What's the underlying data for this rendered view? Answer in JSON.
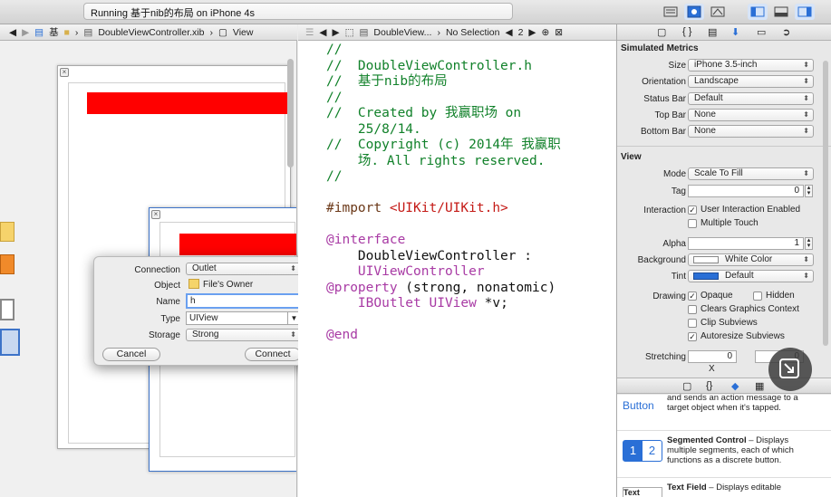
{
  "toolbar": {
    "status": "Running 基于nib的布局 on iPhone 4s"
  },
  "left_jumpbar": {
    "crumbs": [
      "基",
      "DoubleViewController.xib",
      "View"
    ]
  },
  "right_jumpbar": {
    "file": "DoubleView...",
    "selection": "No Selection",
    "counter": "2"
  },
  "editor": {
    "lines": [
      {
        "cls": "cmt",
        "text": "//"
      },
      {
        "cls": "cmt",
        "text": "//  DoubleViewController.h"
      },
      {
        "cls": "cmt",
        "text": "//  基于nib的布局"
      },
      {
        "cls": "cmt",
        "text": "//"
      },
      {
        "cls": "cmt",
        "text": "//  Created by 我赢职场 on"
      },
      {
        "cls": "cmt",
        "text": "    25/8/14."
      },
      {
        "cls": "cmt",
        "text": "//  Copyright (c) 2014年 我赢职"
      },
      {
        "cls": "cmt",
        "text": "    场. All rights reserved."
      },
      {
        "cls": "cmt",
        "text": "//"
      },
      {
        "cls": "plain",
        "text": ""
      },
      {
        "cls": "pre",
        "text": "#import "
      },
      {
        "cls": "plain",
        "text": ""
      },
      {
        "cls": "kw",
        "text": "@interface"
      },
      {
        "cls": "plain",
        "text": "    DoubleViewController :"
      },
      {
        "cls": "kw",
        "text": "    UIViewController"
      },
      {
        "cls": "kw",
        "text": "@property"
      },
      {
        "cls": "kw",
        "text": "    IBOutlet UIView"
      },
      {
        "cls": "plain",
        "text": ""
      },
      {
        "cls": "kw",
        "text": "@end"
      }
    ],
    "import_target": "<UIKit/UIKit.h>",
    "property_attrs": " (strong, nonatomic)",
    "outlet_var": " *v;"
  },
  "dialog": {
    "connection_label": "Connection",
    "connection_value": "Outlet",
    "object_label": "Object",
    "object_value": "File's Owner",
    "name_label": "Name",
    "name_value": "h",
    "type_label": "Type",
    "type_value": "UIView",
    "storage_label": "Storage",
    "storage_value": "Strong",
    "cancel": "Cancel",
    "connect": "Connect"
  },
  "inspector": {
    "simulated_title": "Simulated Metrics",
    "size_label": "Size",
    "size_value": "iPhone 3.5-inch",
    "orientation_label": "Orientation",
    "orientation_value": "Landscape",
    "statusbar_label": "Status Bar",
    "statusbar_value": "Default",
    "topbar_label": "Top Bar",
    "topbar_value": "None",
    "bottombar_label": "Bottom Bar",
    "bottombar_value": "None",
    "view_title": "View",
    "mode_label": "Mode",
    "mode_value": "Scale To Fill",
    "tag_label": "Tag",
    "tag_value": "0",
    "interaction_label": "Interaction",
    "user_interaction": "User Interaction Enabled",
    "multiple_touch": "Multiple Touch",
    "alpha_label": "Alpha",
    "alpha_value": "1",
    "background_label": "Background",
    "background_value": "White Color",
    "tint_label": "Tint",
    "tint_value": "Default",
    "drawing_label": "Drawing",
    "opaque": "Opaque",
    "hidden": "Hidden",
    "clears_graphics": "Clears Graphics Context",
    "clip_subviews": "Clip Subviews",
    "autoresize": "Autoresize Subviews",
    "stretching_label": "Stretching",
    "stretch_x_value": "0",
    "stretch_y_value": "0",
    "stretch_x": "X"
  },
  "library": {
    "items": [
      {
        "icon": "Button",
        "title": "",
        "desc": "and sends an action message to a target object when it's tapped."
      },
      {
        "icon": "1 2",
        "title": "Segmented Control",
        "desc": " – Displays multiple segments, each of which functions as a discrete button."
      },
      {
        "icon": "Text",
        "title": "Text Field",
        "desc": " – Displays editable"
      }
    ]
  },
  "colors": {
    "accent": "#2a6fd6",
    "red_view": "#ff0000",
    "comment": "#11812a",
    "keyword": "#a83aa4",
    "string": "#c41a16"
  }
}
